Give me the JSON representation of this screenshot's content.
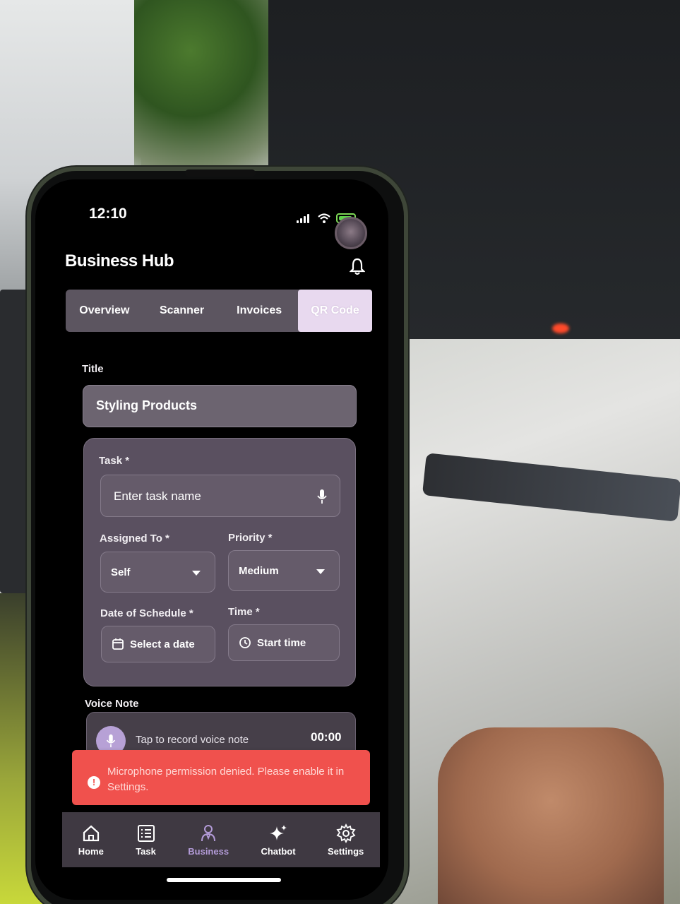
{
  "status_bar": {
    "time": "12:10"
  },
  "header": {
    "title": "Business Hub"
  },
  "tabs": [
    {
      "label": "Overview",
      "active": false
    },
    {
      "label": "Scanner",
      "active": false
    },
    {
      "label": "Invoices",
      "active": false
    },
    {
      "label": "QR Code",
      "active": true
    }
  ],
  "form": {
    "title_label": "Title",
    "title_value": "Styling Products",
    "task_label": "Task *",
    "task_placeholder": "Enter task name",
    "assigned_label": "Assigned To *",
    "assigned_value": "Self",
    "priority_label": "Priority *",
    "priority_value": "Medium",
    "date_label": "Date of Schedule *",
    "date_placeholder": "Select a date",
    "time_label": "Time *",
    "time_placeholder": "Start time"
  },
  "voice_note": {
    "label": "Voice Note",
    "prompt": "Tap to record voice note",
    "timer": "00:00"
  },
  "toast": {
    "message": "Microphone permission denied. Please enable it in Settings.",
    "color": "#f0514d"
  },
  "bottom_nav": [
    {
      "label": "Home",
      "icon": "home-icon",
      "active": false
    },
    {
      "label": "Task",
      "icon": "task-list-icon",
      "active": false
    },
    {
      "label": "Business",
      "icon": "business-person-icon",
      "active": true
    },
    {
      "label": "Chatbot",
      "icon": "sparkle-icon",
      "active": false
    },
    {
      "label": "Settings",
      "icon": "gear-icon",
      "active": false
    }
  ],
  "colors": {
    "accent": "#b39bd8",
    "background": "#000000"
  }
}
